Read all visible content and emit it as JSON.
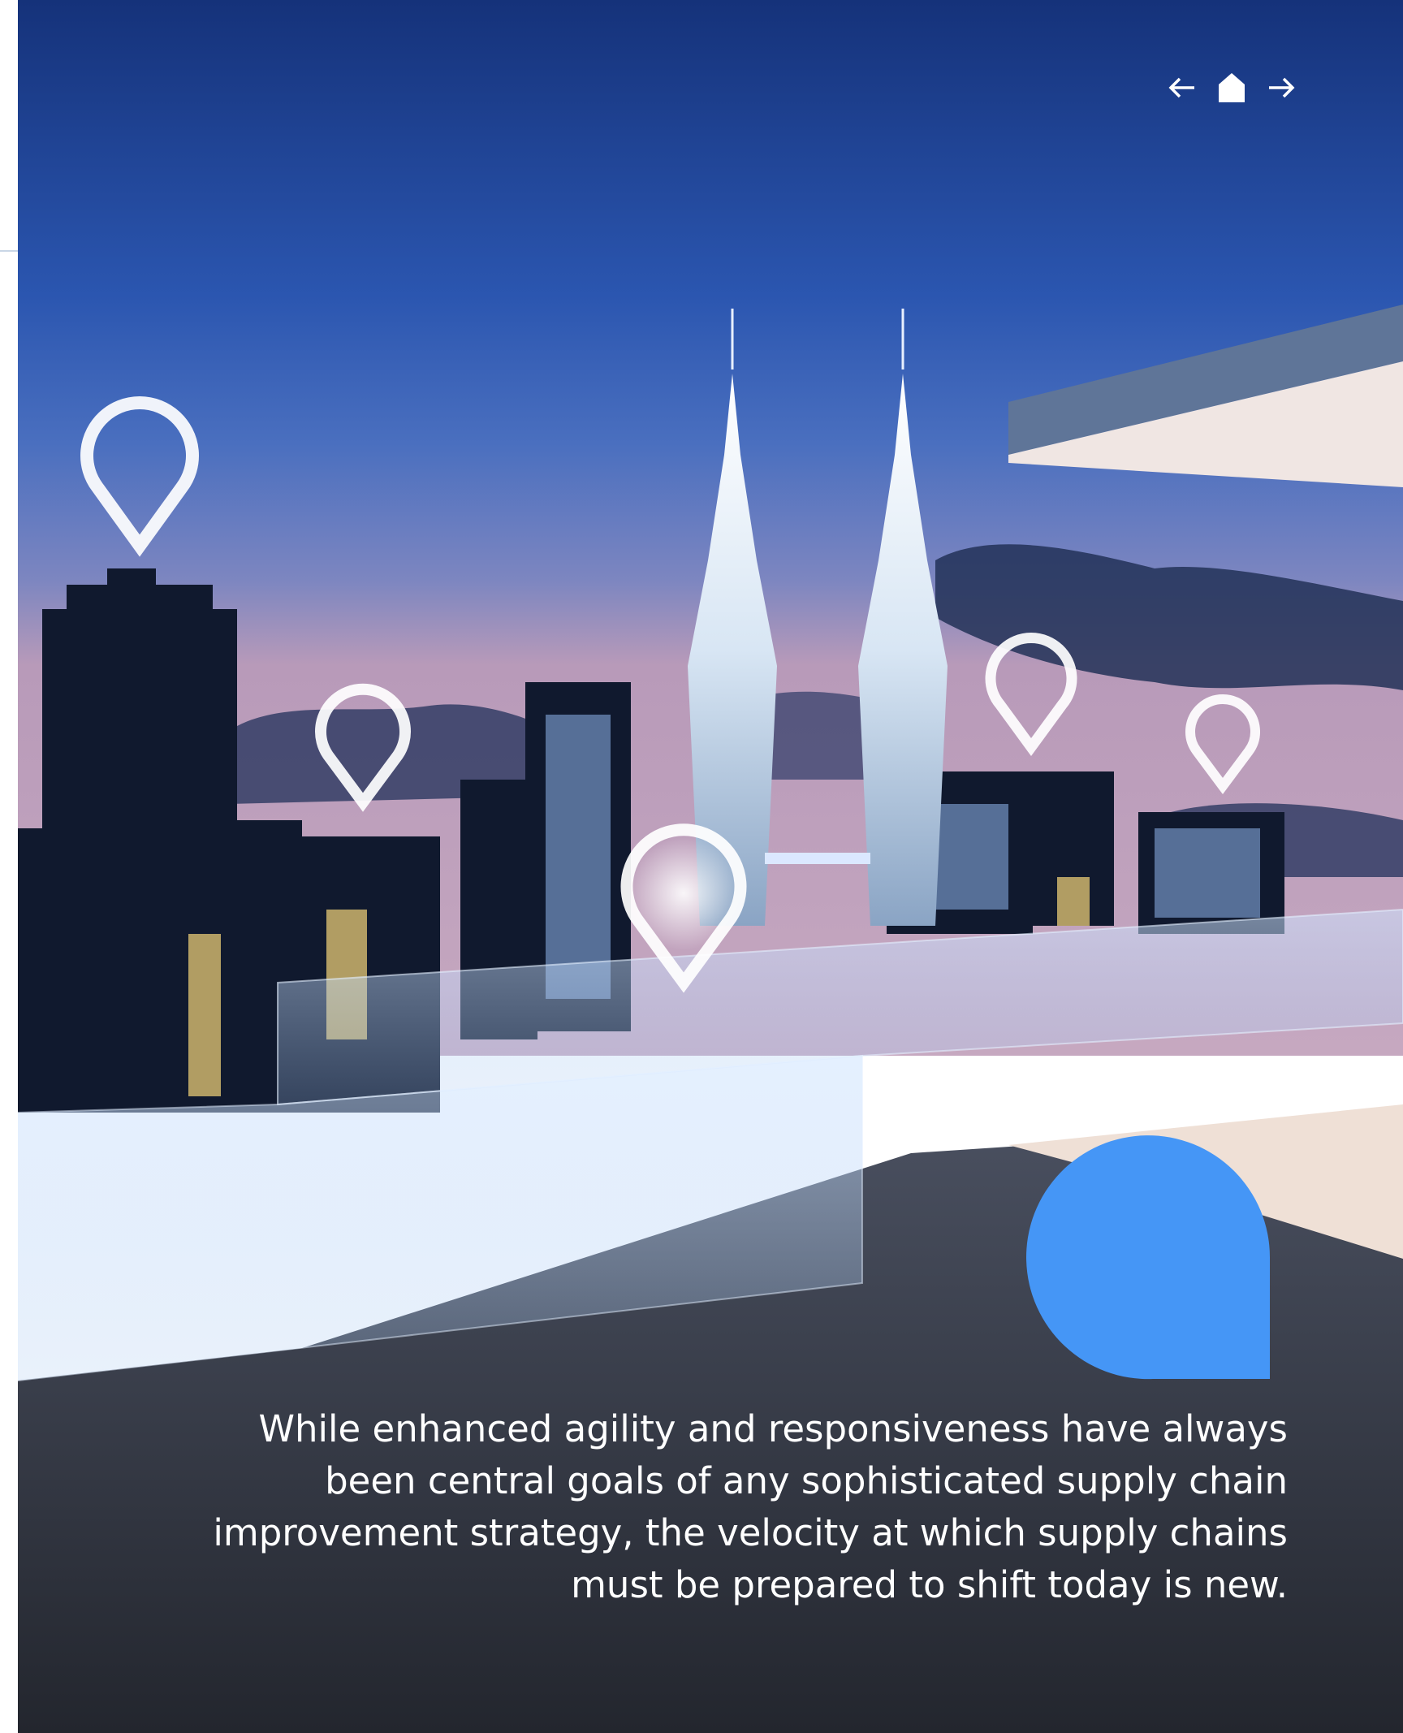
{
  "navigation": {
    "previous_icon": "arrow-left-icon",
    "home_icon": "home-icon",
    "next_icon": "arrow-right-icon"
  },
  "image": {
    "subject": "city-skyline-rooftop-with-location-pins",
    "pin_icon": "map-pin-icon"
  },
  "quote": {
    "lines": [
      "While enhanced agility and responsiveness have always",
      "been central goals of any sophisticated supply chain",
      "improvement strategy, the velocity at which supply chains",
      "must be prepared to shift today is new."
    ]
  },
  "colors": {
    "accent_blue": "#4596f6",
    "text": "#ffffff"
  }
}
